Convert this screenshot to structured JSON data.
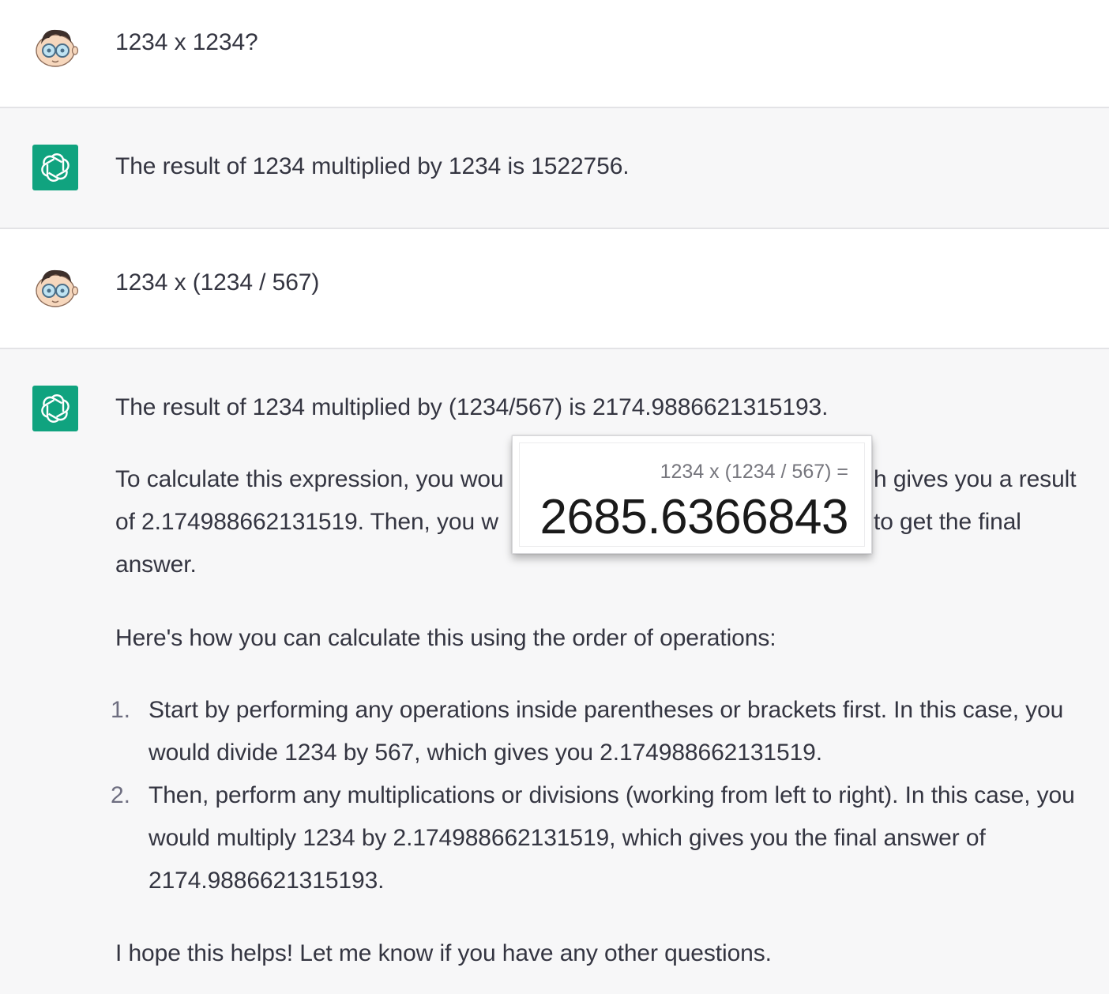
{
  "conversation": {
    "messages": [
      {
        "role": "user",
        "text": "1234 x 1234?"
      },
      {
        "role": "assistant",
        "text": "The result of 1234 multiplied by 1234 is 1522756."
      },
      {
        "role": "user",
        "text": "1234 x (1234 / 567)"
      },
      {
        "role": "assistant",
        "intro": "The result of 1234 multiplied by (1234/567) is 2174.9886621315193.",
        "para1_line1_start": "To calculate this expression, you wou",
        "para1_line1_end": "h gives you a result",
        "para1_line2_start": "of 2.174988662131519. Then, you w",
        "para1_line2_end": "to get the final",
        "para1_line3": "answer.",
        "para2": "Here's how you can calculate this using the order of operations:",
        "steps": [
          {
            "number": "1.",
            "text": "Start by performing any operations inside parentheses or brackets first. In this case, you would divide 1234 by 567, which gives you 2.174988662131519."
          },
          {
            "number": "2.",
            "text": "Then, perform any multiplications or divisions (working from left to right). In this case, you would multiply 1234 by 2.174988662131519, which gives you the final answer of 2174.9886621315193."
          }
        ],
        "closing": "I hope this helps! Let me know if you have any other questions."
      }
    ]
  },
  "calculator_popup": {
    "expression": "1234 x (1234 / 567) =",
    "result": "2685.6366843"
  },
  "colors": {
    "assistant_avatar": "#10a37f",
    "user_row_bg": "#ffffff",
    "assistant_row_bg": "#f7f7f8",
    "text": "#343541"
  },
  "icons": {
    "user_avatar": "cartoon-face-avatar-icon",
    "assistant_avatar": "openai-logo-icon"
  }
}
